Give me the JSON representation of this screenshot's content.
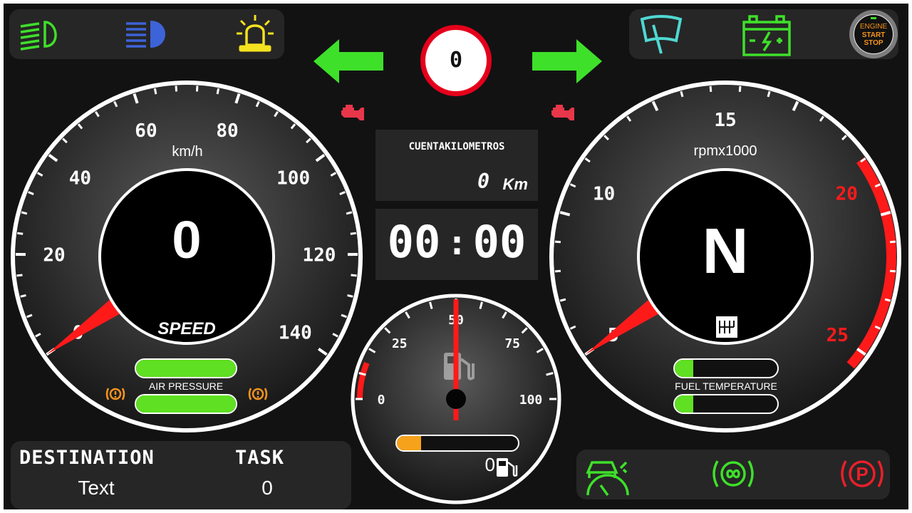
{
  "turn_signals": {
    "left": "left-arrow",
    "right": "right-arrow",
    "color": "#3ee02a"
  },
  "speed_limit": {
    "value": "0"
  },
  "speedometer": {
    "unit": "km/h",
    "ticks": [
      "0",
      "20",
      "40",
      "60",
      "80",
      "100",
      "120",
      "140"
    ],
    "value": "0",
    "label": "SPEED",
    "needle_value": 0
  },
  "tachometer": {
    "unit": "rpmx1000",
    "ticks": [
      "5",
      "10",
      "15",
      "20",
      "25"
    ],
    "gear": "N",
    "redline_from": 20,
    "needle_value": 0
  },
  "odometer": {
    "title": "CUENTAKILOMETROS",
    "value": "0",
    "unit": "Km"
  },
  "clock": {
    "hours": "00",
    "separator": ":",
    "minutes": "00"
  },
  "fuel_gauge": {
    "ticks": [
      "0",
      "25",
      "50",
      "75",
      "100"
    ],
    "value": "0",
    "needle_value": 50,
    "bar_fraction": 0.22
  },
  "air_pressure": {
    "label": "AIR PRESSURE",
    "bar1_fraction": 1.0,
    "bar2_fraction": 1.0
  },
  "fuel_temperature": {
    "label": "FUEL TEMPERATURE",
    "bar1_fraction": 0.2,
    "bar2_fraction": 0.2
  },
  "destination": {
    "title": "DESTINATION",
    "value": "Text"
  },
  "task": {
    "title": "TASK",
    "value": "0"
  },
  "top_left_icons": [
    "low-beam-icon",
    "high-beam-icon",
    "hazard-beacon-icon"
  ],
  "top_right_icons": [
    "wiper-icon",
    "battery-icon",
    "engine-start-stop-icon"
  ],
  "start_stop": {
    "line1": "ENGINE",
    "line2": "START",
    "line3": "STOP"
  },
  "bottom_right_icons": [
    "stability-control-icon",
    "brake-system-icon",
    "parking-brake-icon"
  ],
  "colors": {
    "green": "#3ee02a",
    "blue": "#3d63d8",
    "yellow": "#f3e21f",
    "cyan": "#4fd8d2",
    "red": "#ff1a1a",
    "orange": "#f7941d",
    "engine_warning": "#e8364a"
  }
}
